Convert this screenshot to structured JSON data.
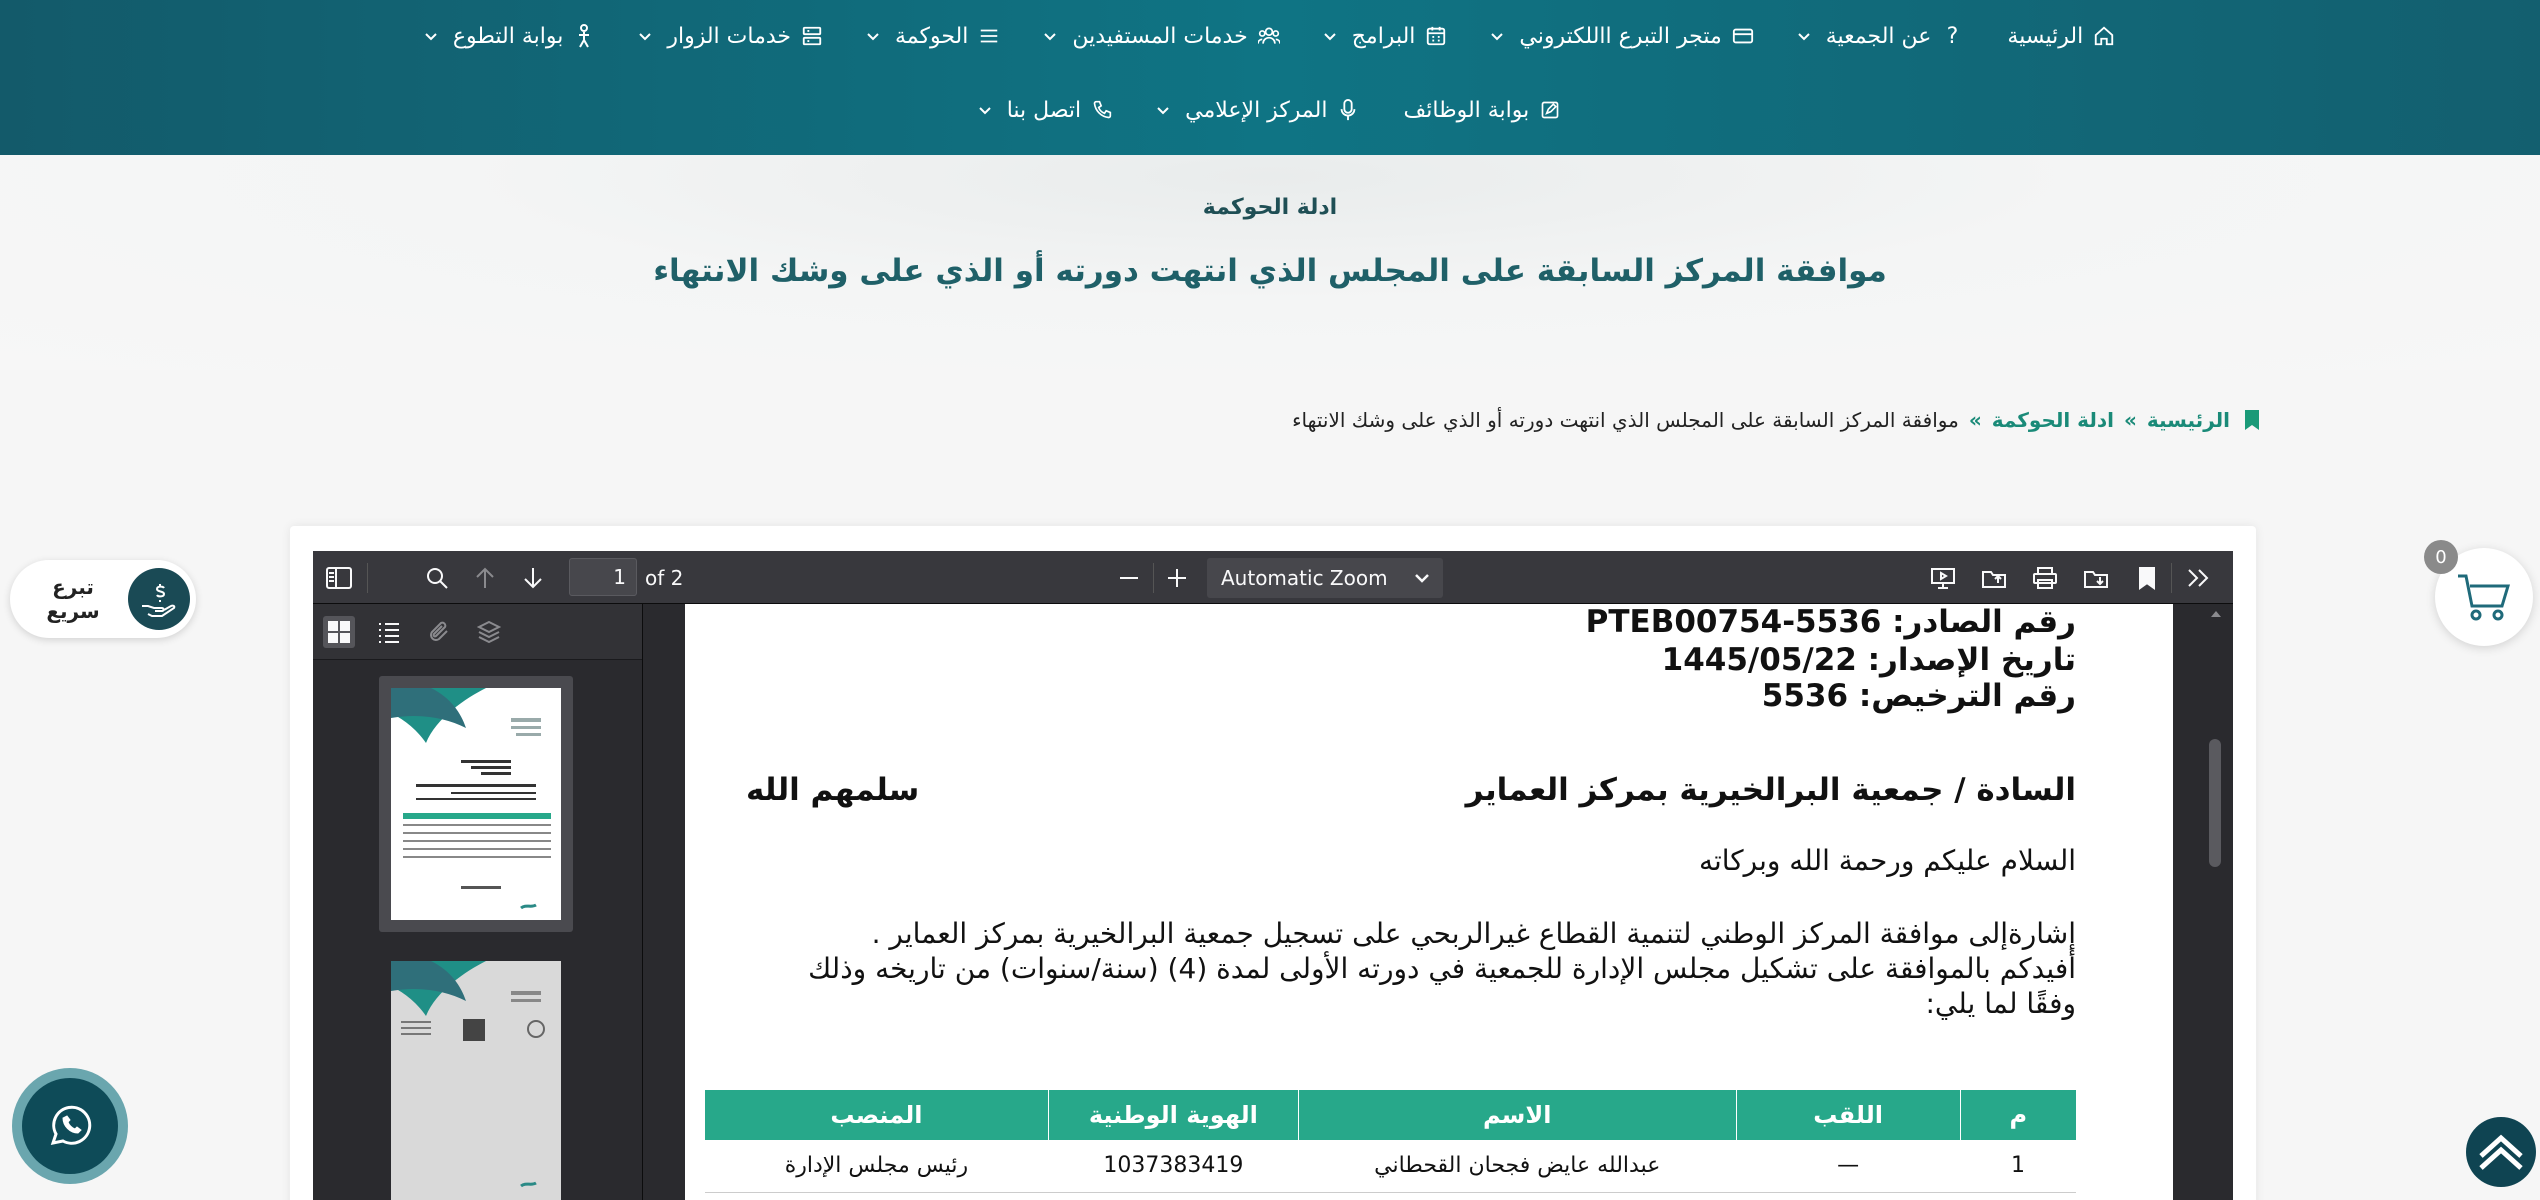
{
  "nav": {
    "row1": [
      {
        "label": "الرئيسية",
        "icon": "home-icon",
        "dropdown": false
      },
      {
        "label": "عن الجمعية",
        "icon": "question-icon",
        "dropdown": true
      },
      {
        "label": "متجر التبرع االلكتروني",
        "icon": "card-icon",
        "dropdown": true
      },
      {
        "label": "البرامج",
        "icon": "calendar-icon",
        "dropdown": true
      },
      {
        "label": "خدمات المستفيدين",
        "icon": "users-icon",
        "dropdown": true
      },
      {
        "label": "الحوكمة",
        "icon": "list-icon",
        "dropdown": true
      },
      {
        "label": "خدمات الزوار",
        "icon": "server-icon",
        "dropdown": true
      },
      {
        "label": "بوابة التطوع",
        "icon": "person-icon",
        "dropdown": true
      }
    ],
    "row2": [
      {
        "label": "بوابة الوظائف",
        "icon": "edit-icon",
        "dropdown": false
      },
      {
        "label": "المركز الإعلامي",
        "icon": "mic-icon",
        "dropdown": true
      },
      {
        "label": "اتصل بنا",
        "icon": "phone-icon",
        "dropdown": true
      }
    ]
  },
  "hero": {
    "subtitle": "ادلة الحوكمة",
    "title": "موافقة المركز السابقة على المجلس الذي انتهت دورته أو الذي على وشك الانتهاء"
  },
  "breadcrumb": {
    "home": "الرئيسية",
    "sep1": "»",
    "section": "ادلة الحوكمة",
    "sep2": "»",
    "current": "موافقة المركز السابقة على المجلس الذي انتهت دورته أو الذي على وشك الانتهاء"
  },
  "viewer": {
    "page_value": "1",
    "page_count": "of 2",
    "zoom": "Automatic Zoom"
  },
  "pdf": {
    "ref_line": "رقم الصادر: PTEB00754-5536",
    "date_line": "تاريخ الإصدار: 1445/05/22",
    "license_line": "رقم الترخيص: 5536",
    "addressee": "السادة / جمعية البرالخيرية بمركز العماير",
    "greeting_right": "سلمهم الله",
    "salutation": "السلام عليكم ورحمة الله وبركاته",
    "body1": "إشارةإلى موافقة المركز الوطني لتنمية القطاع غيرالربحي على تسجيل جمعية البرالخيرية بمركز العماير .",
    "body2": "أفيدكم بالموافقة على تشكيل مجلس الإدارة للجمعية في دورته الأولى لمدة (4) (سنة/سنوات) من تاريخه وذلك",
    "body3": "وفقًا لما يلي:",
    "table": {
      "headers": [
        "م",
        "اللقب",
        "الاسم",
        "الهوية الوطنية",
        "المنصب"
      ],
      "rows": [
        [
          "1",
          "—",
          "عبدالله عايض فجحان القحطاني",
          "1037383419",
          "رئيس مجلس الإدارة"
        ]
      ]
    }
  },
  "widgets": {
    "donate_label": "تبرع سريع",
    "cart_count": "0"
  },
  "colors": {
    "header": "#0f7484",
    "accent": "#1a8a78",
    "table_header": "#27a88a"
  }
}
